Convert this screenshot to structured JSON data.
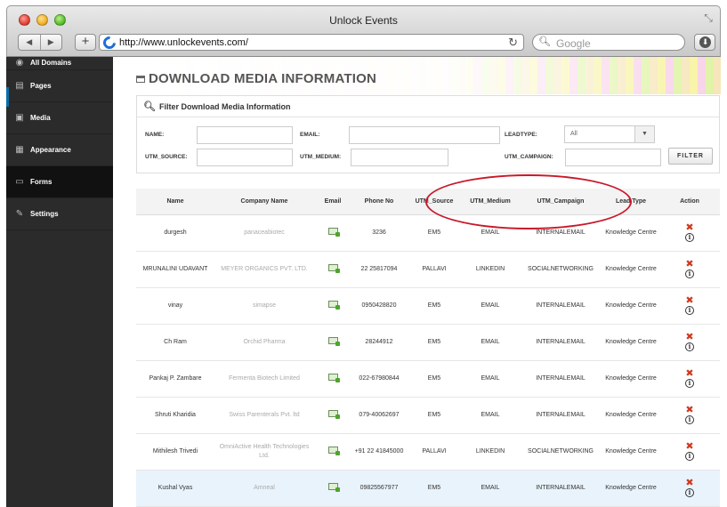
{
  "window": {
    "title": "Unlock Events"
  },
  "browser": {
    "url": "http://www.unlockevents.com/",
    "search_placeholder": "Google",
    "back": "◀",
    "forward": "▶",
    "add": "+"
  },
  "sidebar": {
    "items": [
      {
        "label": "All Domains",
        "icon": "globe-icon"
      },
      {
        "label": "Pages",
        "icon": "pages-icon"
      },
      {
        "label": "Media",
        "icon": "media-icon"
      },
      {
        "label": "Appearance",
        "icon": "appearance-icon"
      },
      {
        "label": "Forms",
        "icon": "forms-icon"
      },
      {
        "label": "Settings",
        "icon": "wrench-icon"
      }
    ]
  },
  "page": {
    "title": "DOWNLOAD MEDIA INFORMATION"
  },
  "filter": {
    "heading": "Filter Download Media Information",
    "name_label": "NAME:",
    "email_label": "EMAIL:",
    "leadtype_label": "LEADTYPE:",
    "leadtype_value": "All",
    "utm_source_label": "UTM_SOURCE:",
    "utm_medium_label": "UTM_MEDIUM:",
    "utm_campaign_label": "UTM_CAMPAIGN:",
    "button": "FILTER"
  },
  "table": {
    "columns": [
      "Name",
      "Company Name",
      "Email",
      "Phone No",
      "UTM_Source",
      "UTM_Medium",
      "UTM_Campaign",
      "Lead Type",
      "Action"
    ],
    "rows": [
      {
        "name": "durgesh",
        "company": "panaceabiotec",
        "phone": "3236",
        "source": "EM5",
        "medium": "EMAIL",
        "campaign": "INTERNALEMAIL",
        "lead": "Knowledge Centre"
      },
      {
        "name": "MRUNALINI UDAVANT",
        "company": "MEYER ORGANICS PVT. LTD.",
        "phone": "22 25817094",
        "source": "PALLAVI",
        "medium": "LINKEDIN",
        "campaign": "SOCIALNETWORKING",
        "lead": "Knowledge Centre"
      },
      {
        "name": "vinay",
        "company": "simapse",
        "phone": "0950428820",
        "source": "EM5",
        "medium": "EMAIL",
        "campaign": "INTERNALEMAIL",
        "lead": "Knowledge Centre"
      },
      {
        "name": "Ch Ram",
        "company": "Orchid Pharma",
        "phone": "28244912",
        "source": "EM5",
        "medium": "EMAIL",
        "campaign": "INTERNALEMAIL",
        "lead": "Knowledge Centre"
      },
      {
        "name": "Pankaj P. Zambare",
        "company": "Fermenta Biotech Limited",
        "phone": "022-67980844",
        "source": "EM5",
        "medium": "EMAIL",
        "campaign": "INTERNALEMAIL",
        "lead": "Knowledge Centre"
      },
      {
        "name": "Shruti Kharidia",
        "company": "Swiss Parenterals Pvt. ltd",
        "phone": "079-40062697",
        "source": "EM5",
        "medium": "EMAIL",
        "campaign": "INTERNALEMAIL",
        "lead": "Knowledge Centre"
      },
      {
        "name": "Mithilesh Trivedi",
        "company": "OmniActive Health Technologies Ltd.",
        "phone": "+91 22 41845000",
        "source": "PALLAVI",
        "medium": "LINKEDIN",
        "campaign": "SOCIALNETWORKING",
        "lead": "Knowledge Centre"
      },
      {
        "name": "Kushal Vyas",
        "company": "Amneal",
        "phone": "09825567977",
        "source": "EM5",
        "medium": "EMAIL",
        "campaign": "INTERNALEMAIL",
        "lead": "Knowledge Centre"
      }
    ]
  },
  "colors": {
    "accent": "#0a6ea8",
    "annotation": "#c8192a",
    "delete": "#d03a1f"
  }
}
